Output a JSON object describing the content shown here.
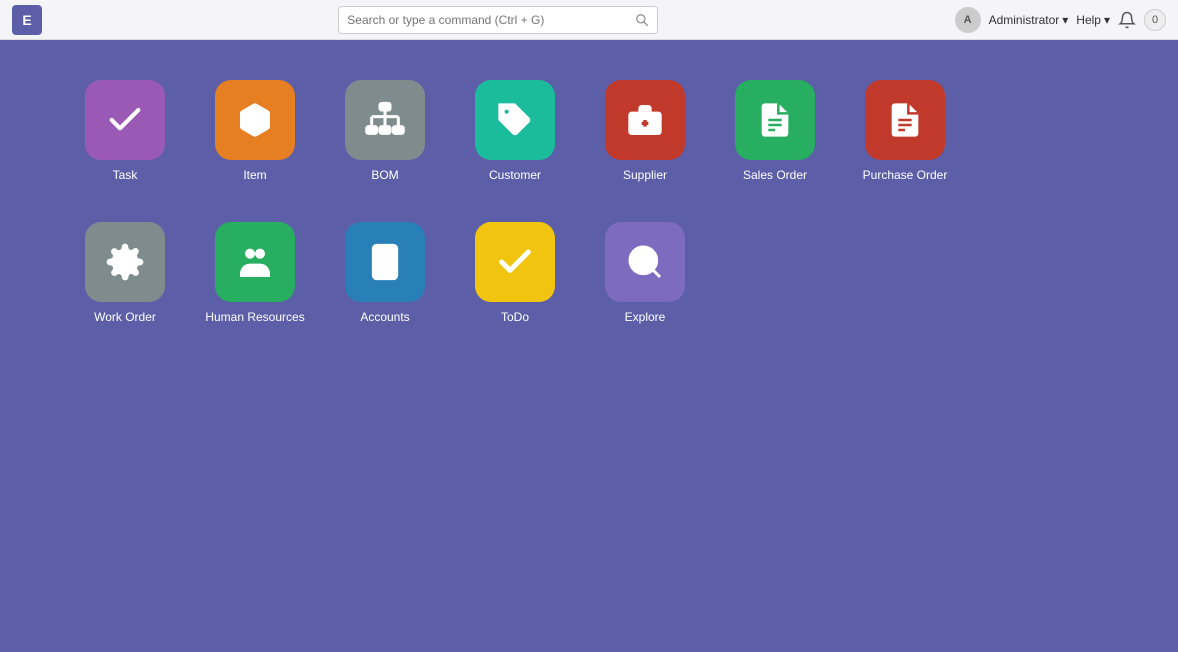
{
  "header": {
    "logo_text": "E",
    "search_placeholder": "Search or type a command (Ctrl + G)",
    "admin_label": "Administrator",
    "admin_dropdown": "▾",
    "help_label": "Help",
    "help_dropdown": "▾",
    "notification_count": "0"
  },
  "apps": {
    "row1": [
      {
        "id": "task",
        "label": "Task",
        "icon_color": "icon-task",
        "icon_name": "task-icon"
      },
      {
        "id": "item",
        "label": "Item",
        "icon_color": "icon-item",
        "icon_name": "item-icon"
      },
      {
        "id": "bom",
        "label": "BOM",
        "icon_color": "icon-bom",
        "icon_name": "bom-icon"
      },
      {
        "id": "customer",
        "label": "Customer",
        "icon_color": "icon-customer",
        "icon_name": "customer-icon"
      },
      {
        "id": "supplier",
        "label": "Supplier",
        "icon_color": "icon-supplier",
        "icon_name": "supplier-icon"
      },
      {
        "id": "sales-order",
        "label": "Sales Order",
        "icon_color": "icon-sales-order",
        "icon_name": "sales-order-icon"
      },
      {
        "id": "purchase-order",
        "label": "Purchase Order",
        "icon_color": "icon-purchase-order",
        "icon_name": "purchase-order-icon"
      }
    ],
    "row2": [
      {
        "id": "work-order",
        "label": "Work Order",
        "icon_color": "icon-work-order",
        "icon_name": "work-order-icon"
      },
      {
        "id": "human-resources",
        "label": "Human Resources",
        "icon_color": "icon-human-resources",
        "icon_name": "human-resources-icon"
      },
      {
        "id": "accounts",
        "label": "Accounts",
        "icon_color": "icon-accounts",
        "icon_name": "accounts-icon"
      },
      {
        "id": "todo",
        "label": "ToDo",
        "icon_color": "icon-todo",
        "icon_name": "todo-icon"
      },
      {
        "id": "explore",
        "label": "Explore",
        "icon_color": "icon-explore",
        "icon_name": "explore-icon"
      }
    ]
  }
}
